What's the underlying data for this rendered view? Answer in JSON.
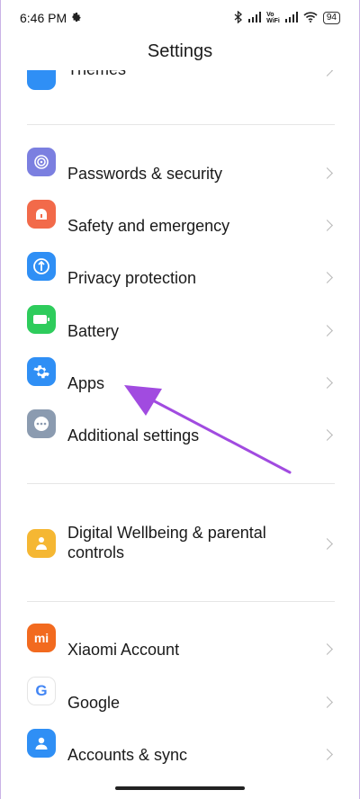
{
  "status_bar": {
    "time": "6:46 PM",
    "vowifi_top": "Vo",
    "vowifi_bottom": "WiFi",
    "battery": "94"
  },
  "header": {
    "title": "Settings"
  },
  "groups": [
    {
      "items": [
        {
          "label": "Themes",
          "icon": "themes-icon",
          "color": "#2f8ff5"
        }
      ]
    },
    {
      "items": [
        {
          "label": "Passwords & security",
          "icon": "fingerprint-icon",
          "color": "#7b7fe0"
        },
        {
          "label": "Safety and emergency",
          "icon": "emergency-icon",
          "color": "#f26a4a"
        },
        {
          "label": "Privacy protection",
          "icon": "shield-icon",
          "color": "#2f8ff5"
        },
        {
          "label": "Battery",
          "icon": "battery-icon",
          "color": "#2ecc5c"
        },
        {
          "label": "Apps",
          "icon": "gear-icon",
          "color": "#2f8ff5"
        },
        {
          "label": "Additional settings",
          "icon": "more-icon",
          "color": "#8b9bb0"
        }
      ]
    },
    {
      "items": [
        {
          "label": "Digital Wellbeing & parental controls",
          "icon": "wellbeing-icon",
          "color": "#f5b733"
        }
      ]
    },
    {
      "items": [
        {
          "label": "Xiaomi Account",
          "icon": "mi-icon",
          "color": "#f26a1f"
        },
        {
          "label": "Google",
          "icon": "google-icon",
          "color": "#ffffff"
        },
        {
          "label": "Accounts & sync",
          "icon": "account-icon",
          "color": "#2f8ff5"
        }
      ]
    }
  ],
  "colors": {
    "annotation_arrow": "#a14be0"
  },
  "mi_logo_text": "mi",
  "google_logo_text": "G"
}
